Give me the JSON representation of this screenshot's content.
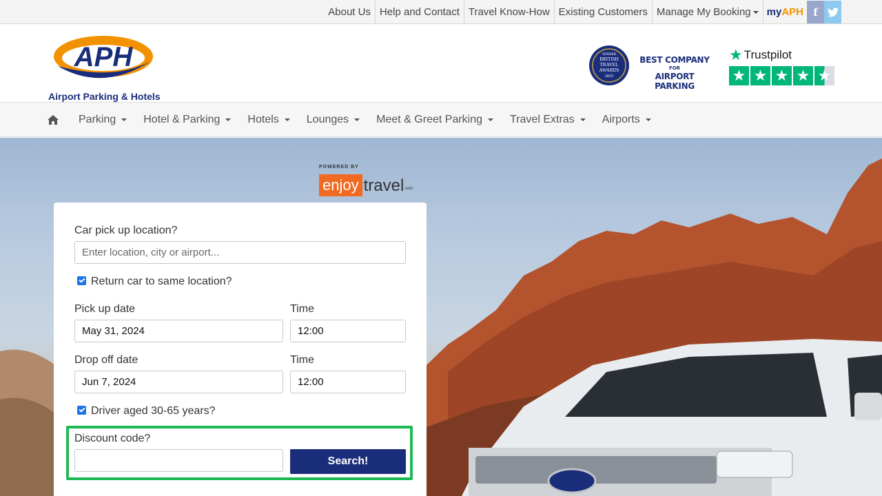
{
  "topbar": {
    "links": [
      "About Us",
      "Help and Contact",
      "Travel Know-How",
      "Existing Customers",
      "Manage My Booking"
    ],
    "myaph_prefix": "my",
    "myaph_suffix": "APH",
    "facebook_glyph": "f",
    "twitter_glyph": "🐦"
  },
  "header": {
    "logo_text": "APH",
    "logo_tagline": "Airport Parking & Hotels",
    "award_lines": [
      "WINNER",
      "BRITISH",
      "TRAVEL",
      "AWARDS",
      "2023"
    ],
    "best_company_line1": "BEST COMPANY",
    "best_company_line2": "FOR",
    "best_company_line3": "AIRPORT PARKING",
    "trustpilot_label": "Trustpilot"
  },
  "nav": {
    "items": [
      "Parking",
      "Hotel & Parking",
      "Hotels",
      "Lounges",
      "Meet & Greet Parking",
      "Travel Extras",
      "Airports"
    ]
  },
  "partner": {
    "powered_by": "POWERED BY",
    "logo_part1": "enjoy",
    "logo_part2": "travel",
    "logo_part3": ".com"
  },
  "form": {
    "pickup_location_label": "Car pick up location?",
    "pickup_location_placeholder": "Enter location, city or airport...",
    "return_same_label": "Return car to same location?",
    "pickup_date_label": "Pick up date",
    "pickup_date_value": "May 31, 2024",
    "pickup_time_label": "Time",
    "pickup_time_value": "12:00",
    "dropoff_date_label": "Drop off date",
    "dropoff_date_value": "Jun 7, 2024",
    "dropoff_time_label": "Time",
    "dropoff_time_value": "12:00",
    "driver_age_label": "Driver aged 30-65 years?",
    "discount_label": "Discount code?",
    "discount_value": "",
    "search_label": "Search!"
  },
  "colors": {
    "brand_blue": "#1a2d7a",
    "brand_orange": "#f39200",
    "trustpilot_green": "#00b67a",
    "highlight_green": "#1db954"
  },
  "icons": [
    "home-icon",
    "facebook-icon",
    "twitter-icon",
    "trustpilot-star-icon",
    "checkbox-icon"
  ]
}
